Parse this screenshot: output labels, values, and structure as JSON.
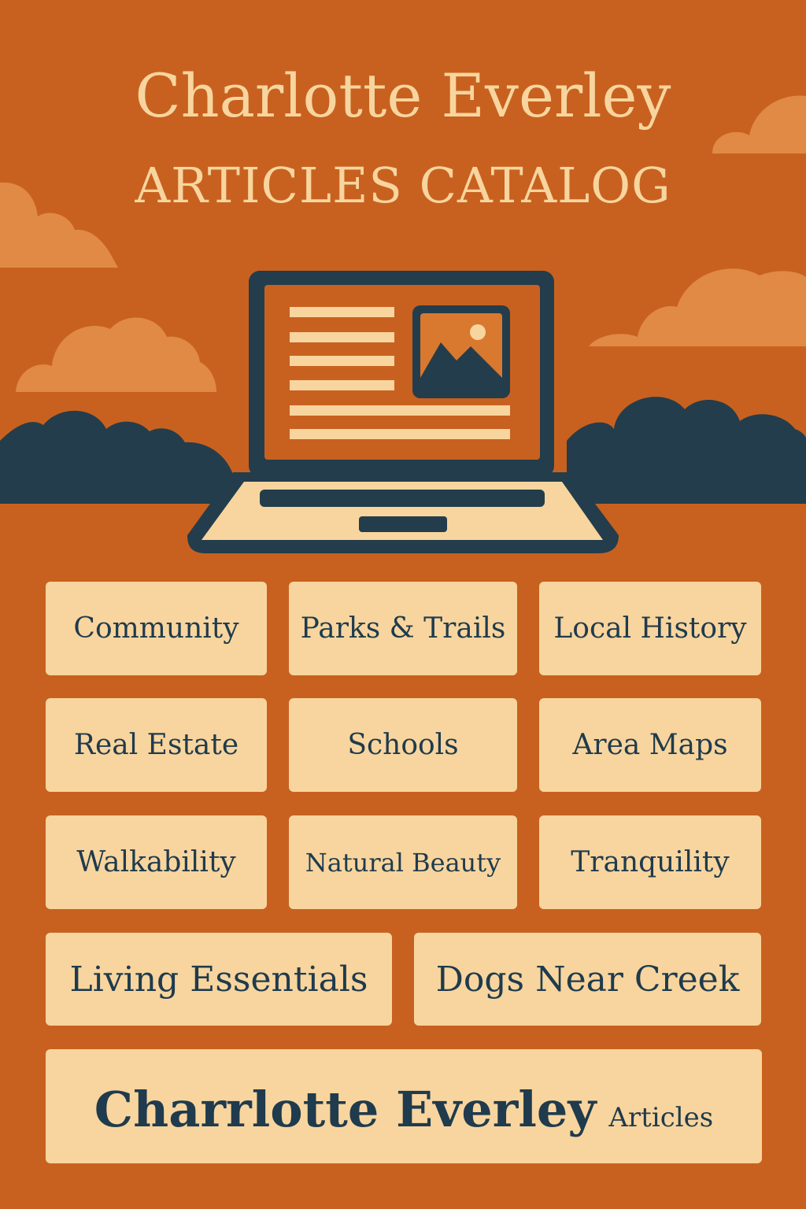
{
  "header": {
    "title": "Charlotte Everley",
    "subtitle": "ARTICLES CATALOG"
  },
  "illustration": {
    "icon": "laptop-article-icon",
    "image_icon": "mountain-image-icon"
  },
  "categories": [
    {
      "label": "Community"
    },
    {
      "label": "Parks & Trails"
    },
    {
      "label": "Local History"
    },
    {
      "label": "Real Estate"
    },
    {
      "label": "Schools"
    },
    {
      "label": "Area Maps"
    },
    {
      "label": "Walkability"
    },
    {
      "label": "Natural Beauty"
    },
    {
      "label": "Tranquility"
    },
    {
      "label": "Living Essentials"
    },
    {
      "label": "Dogs Near Creek"
    }
  ],
  "footer": {
    "main": "Charrlotte Everley",
    "sub": "Articles"
  },
  "colors": {
    "background": "#c8611f",
    "cream": "#f8d59e",
    "navy": "#1f3b4d",
    "cloud": "#e08a45"
  }
}
